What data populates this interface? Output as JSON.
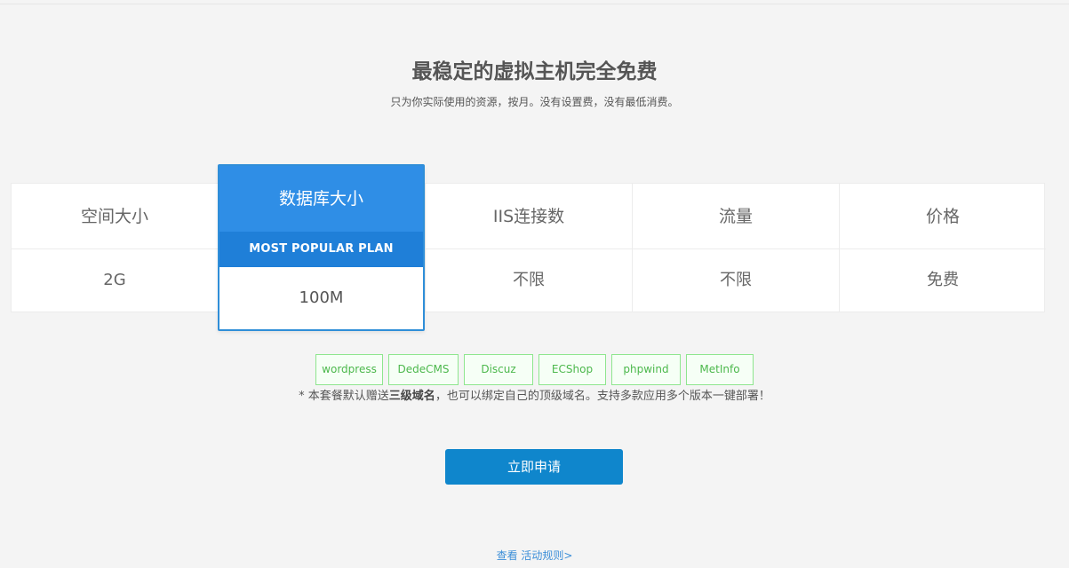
{
  "hero": {
    "title": "最稳定的虚拟主机完全免费",
    "subtitle": "只为你实际使用的资源，按月。没有设置费，没有最低消费。"
  },
  "plan_table": {
    "columns": [
      {
        "header": "空间大小",
        "value": "2G"
      },
      {
        "header": "数据库大小",
        "value": "100M"
      },
      {
        "header": "IIS连接数",
        "value": "不限"
      },
      {
        "header": "流量",
        "value": "不限"
      },
      {
        "header": "价格",
        "value": "免费"
      }
    ],
    "featured_badge": "MOST POPULAR PLAN"
  },
  "tags": [
    "wordpress",
    "DedeCMS",
    "Discuz",
    "ECShop",
    "phpwind",
    "MetInfo"
  ],
  "note": {
    "prefix": "* 本套餐默认赠送",
    "bold": "三级域名",
    "suffix": "，也可以绑定自己的顶级域名。支持多款应用多个版本一键部署！"
  },
  "apply_button": "立即申请",
  "rules_link": "查看 活动规则>",
  "colors": {
    "accent_blue": "#2f8ee6",
    "badge_blue": "#1f7fd8",
    "button_blue": "#0f86cc",
    "tag_green": "#4cb84c"
  }
}
